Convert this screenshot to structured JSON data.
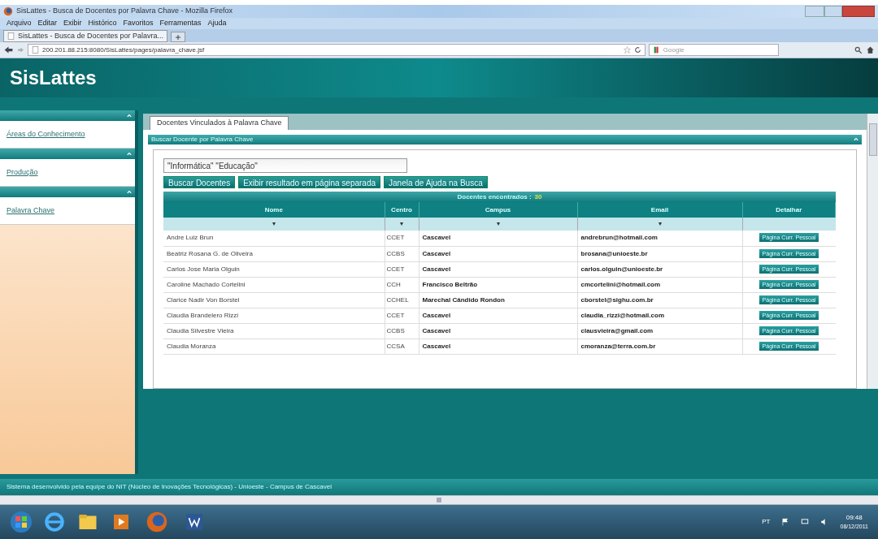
{
  "window": {
    "title": "SisLattes - Busca de Docentes por Palavra Chave - Mozilla Firefox"
  },
  "menu": [
    "Arquivo",
    "Editar",
    "Exibir",
    "Histórico",
    "Favoritos",
    "Ferramentas",
    "Ajuda"
  ],
  "browser_tab": {
    "title": "SisLattes - Busca de Docentes por Palavra..."
  },
  "address_bar": {
    "url": "200.201.88.215:8080/SisLattes/pages/palavra_chave.jsf"
  },
  "search_box": {
    "placeholder": "Google"
  },
  "header": {
    "title": "SisLattes"
  },
  "sidebar": {
    "items": [
      {
        "label": "Áreas do Conhecimento"
      },
      {
        "label": "Produção"
      },
      {
        "label": "Palavra Chave"
      }
    ]
  },
  "content_tab": {
    "label": "Docentes Vinculados à Palavra Chave"
  },
  "panel": {
    "title": "Buscar Docente por Palavra Chave",
    "search": {
      "value": "\"Informática\" \"Educação\""
    },
    "buttons": [
      "Buscar Docentes",
      "Exibir resultado em página separada",
      "Janela de Ajuda na Busca"
    ],
    "results_label": "Docentes encontrados :",
    "results_count": "30",
    "table": {
      "columns": [
        "Nome",
        "Centro",
        "Campus",
        "Email",
        "Detalhar"
      ],
      "filters": [
        "▾",
        "▾",
        "▾",
        "▾"
      ],
      "rows": [
        {
          "nome": "Andre Luiz Brun",
          "centro": "CCET",
          "campus": "Cascavel",
          "email": "andrebrun@hotmail.com",
          "action": "Página Curr. Pessoal"
        },
        {
          "nome": "Beatriz Rosana G. de Oliveira",
          "centro": "CCBS",
          "campus": "Cascavel",
          "email": "brosana@unioeste.br",
          "action": "Página Curr. Pessoal"
        },
        {
          "nome": "Carlos Jose Maria Olguin",
          "centro": "CCET",
          "campus": "Cascavel",
          "email": "carlos.olguin@unioeste.br",
          "action": "Página Curr. Pessoal"
        },
        {
          "nome": "Caroline Machado Cortelini",
          "centro": "CCH",
          "campus": "Francisco Beltrão",
          "email": "cmcortelini@hotmail.com",
          "action": "Página Curr. Pessoal"
        },
        {
          "nome": "Clarice Nadir Von Borstel",
          "centro": "CCHEL",
          "campus": "Marechal Cândido Rondon",
          "email": "cborstel@sighu.com.br",
          "action": "Página Curr. Pessoal"
        },
        {
          "nome": "Claudia Brandelero Rizzi",
          "centro": "CCET",
          "campus": "Cascavel",
          "email": "claudia_rizzi@hotmail.com",
          "action": "Página Curr. Pessoal"
        },
        {
          "nome": "Claudia Silvestre Vieira",
          "centro": "CCBS",
          "campus": "Cascavel",
          "email": "clausvieira@gmail.com",
          "action": "Página Curr. Pessoal"
        },
        {
          "nome": "Claudia Moranza",
          "centro": "CCSA",
          "campus": "Cascavel",
          "email": "cmoranza@terra.com.br",
          "action": "Página Curr. Pessoal"
        }
      ]
    }
  },
  "footer": {
    "text": "Sistema desenvolvido pela equipe do NIT (Núcleo de Inovações Tecnológicas) - Unioeste - Campus de Cascavel"
  },
  "taskbar": {
    "language": "PT",
    "time": "09:48",
    "date": "08/12/2011"
  }
}
